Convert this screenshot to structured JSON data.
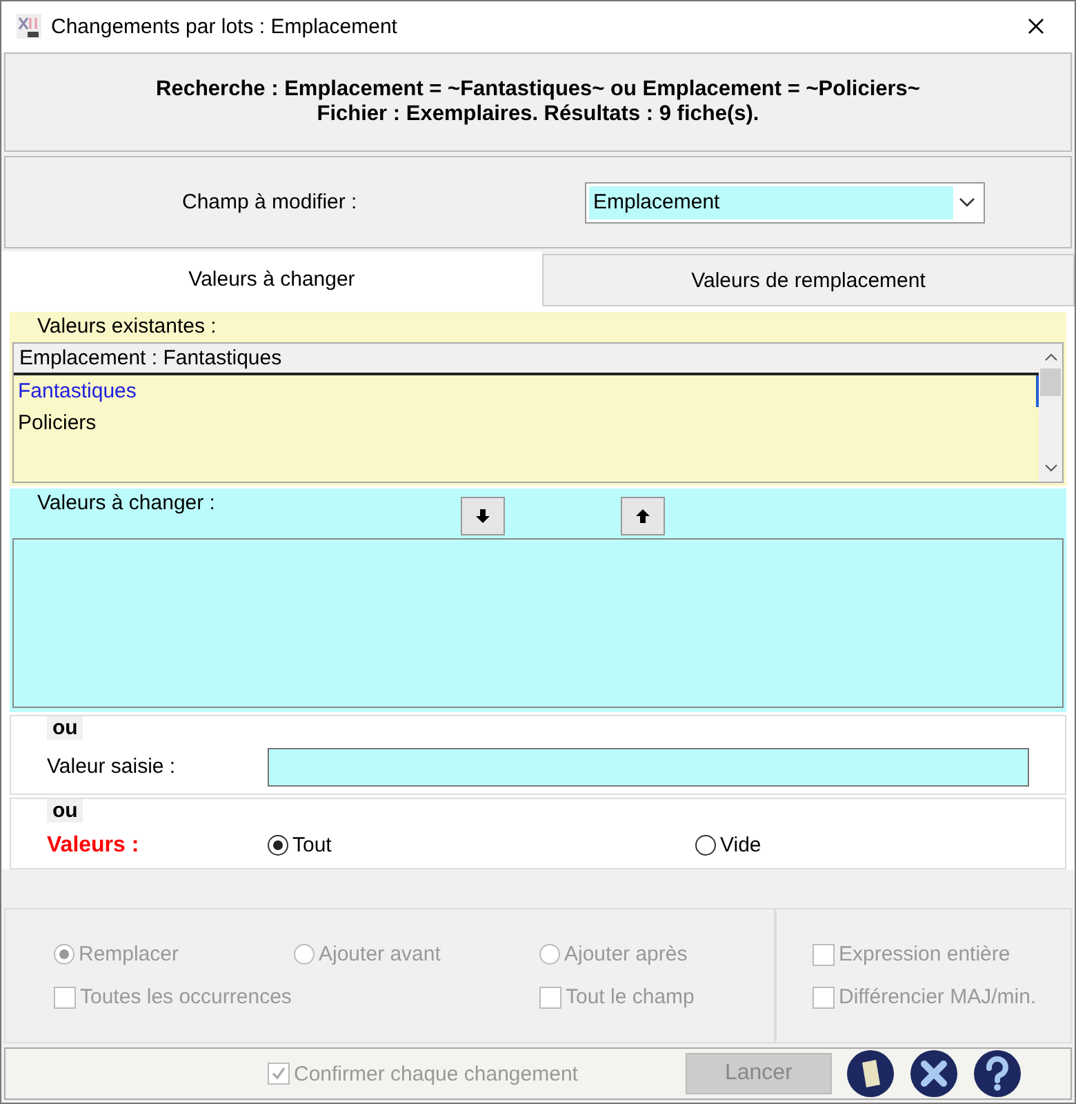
{
  "window": {
    "title": "Changements par lots : Emplacement"
  },
  "search_summary": [
    "Recherche : Emplacement = ~Fantastiques~ ou Emplacement = ~Policiers~",
    "Fichier : Exemplaires. Résultats : 9 fiche(s)."
  ],
  "field": {
    "label": "Champ à modifier :",
    "value": "Emplacement"
  },
  "tabs": [
    {
      "label": "Valeurs à changer",
      "selected": true
    },
    {
      "label": "Valeurs de remplacement",
      "selected": false
    }
  ],
  "existing": {
    "label": "Valeurs existantes :",
    "header": "Emplacement : Fantastiques",
    "items": [
      {
        "label": "Fantastiques",
        "selected": true
      },
      {
        "label": "Policiers",
        "selected": false
      }
    ]
  },
  "to_change": {
    "label": "Valeurs à changer :"
  },
  "typed": {
    "or": "ou",
    "label": "Valeur saisie :"
  },
  "values": {
    "or": "ou",
    "label": "Valeurs :",
    "options": [
      {
        "label": "Tout",
        "selected": true
      },
      {
        "label": "Vide",
        "selected": false
      }
    ]
  },
  "mode_options": [
    {
      "kind": "radio",
      "label": "Remplacer",
      "selected": true,
      "disabled": true
    },
    {
      "kind": "radio",
      "label": "Ajouter avant",
      "selected": false,
      "disabled": true
    },
    {
      "kind": "radio",
      "label": "Ajouter après",
      "selected": false,
      "disabled": true
    },
    {
      "kind": "checkbox",
      "label": "Toutes les occurrences",
      "checked": false,
      "disabled": true
    },
    {
      "kind": "checkbox",
      "label": "Tout le champ",
      "checked": false,
      "disabled": true
    }
  ],
  "match_options": [
    {
      "label": "Expression entière",
      "checked": false,
      "disabled": true
    },
    {
      "label": "Différencier MAJ/min.",
      "checked": false,
      "disabled": true
    }
  ],
  "footer": {
    "confirm": {
      "label": "Confirmer chaque changement",
      "checked": true,
      "disabled": true
    },
    "run_button": {
      "label": "Lancer",
      "disabled": true
    }
  }
}
